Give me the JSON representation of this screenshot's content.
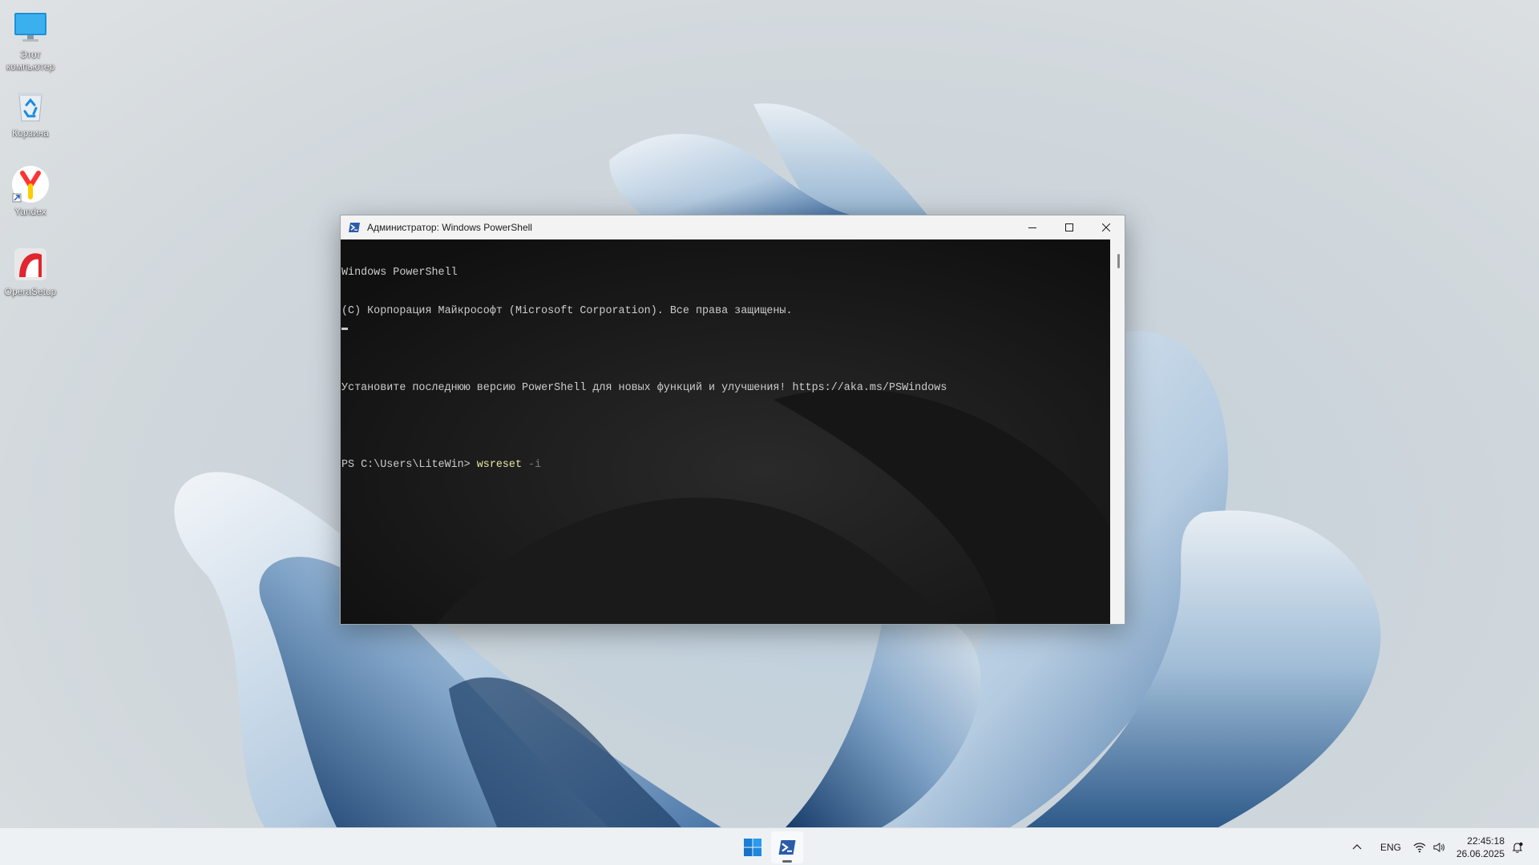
{
  "desktop": {
    "icons": [
      {
        "label": "Этот компьютер",
        "icon": "monitor-icon"
      },
      {
        "label": "Корзина",
        "icon": "recycle-bin-icon"
      },
      {
        "label": "Yandex",
        "icon": "yandex-browser-icon"
      },
      {
        "label": "OperaSetup",
        "icon": "opera-icon"
      }
    ]
  },
  "window": {
    "title": "Администратор: Windows PowerShell",
    "icon": "powershell-icon",
    "controls": {
      "minimize": "minimize-icon",
      "maximize": "maximize-icon",
      "close": "close-icon"
    }
  },
  "console": {
    "lines": [
      "Windows PowerShell",
      "(C) Корпорация Майкрософт (Microsoft Corporation). Все права защищены.",
      "",
      "Установите последнюю версию PowerShell для новых функций и улучшения! https://aka.ms/PSWindows",
      ""
    ],
    "prompt": "PS C:\\Users\\LiteWin> ",
    "command": "wsreset",
    "parameter": " -i"
  },
  "taskbar": {
    "start_icon": "windows-start-icon",
    "pinned_app_icon": "powershell-icon",
    "tray": {
      "chevron": "chevron-up-icon",
      "language": "ENG",
      "wifi": "wifi-icon",
      "volume": "volume-icon",
      "notification": "notification-icon"
    },
    "time": "22:45:18",
    "date": "26.06.2025"
  },
  "colors": {
    "console_bg": "#0c0c0c",
    "console_text": "#cccccc",
    "command_text": "#e7e7a6",
    "parameter_text": "#7a7a7a",
    "powershell_blue": "#2a5caa",
    "start_blue": "#1a7fd8"
  }
}
